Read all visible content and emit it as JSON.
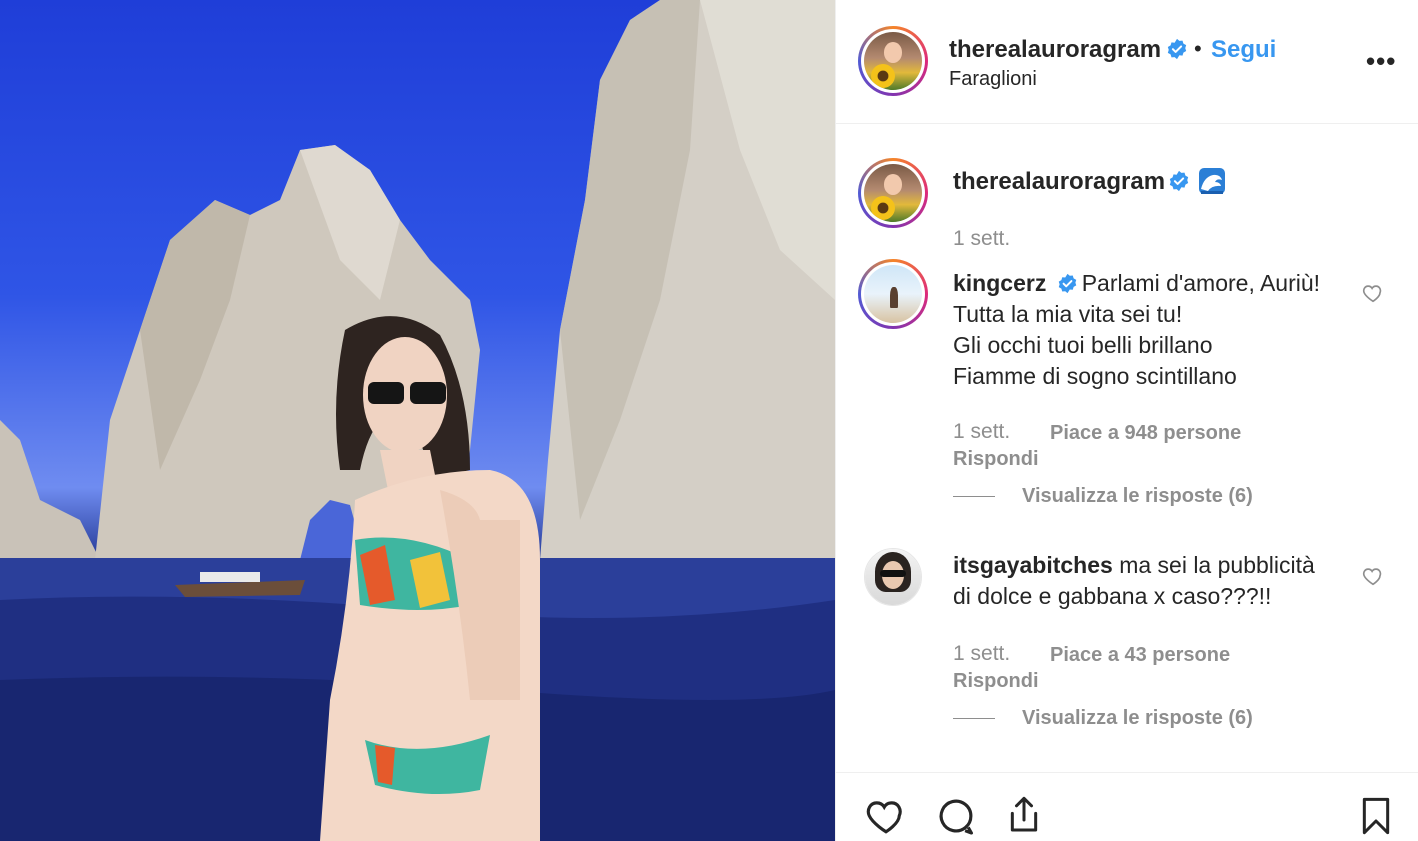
{
  "post": {
    "author": "therealauroragram",
    "follow_label": "Segui",
    "separator": "•",
    "location": "Faraglioni",
    "more_label": "•••"
  },
  "caption": {
    "author": "therealauroragram",
    "emoji_icon": "wave-emoji",
    "time": "1 sett."
  },
  "comments": [
    {
      "author": "kingcerz",
      "verified": true,
      "lines": [
        "Parlami d'amore, Auriù!",
        "Tutta la mia vita sei tu!",
        "Gli occhi tuoi belli brillano",
        "Fiamme di sogno scintillano"
      ],
      "time": "1 sett.",
      "likes": "Piace a 948 persone",
      "reply": "Rispondi",
      "view_replies": "Visualizza le risposte (6)"
    },
    {
      "author": "itsgayabitches",
      "verified": false,
      "lines": [
        "ma sei la pubblicità",
        "di dolce e gabbana x caso???!!"
      ],
      "time": "1 sett.",
      "likes": "Piace a 43 persone",
      "reply": "Rispondi",
      "view_replies": "Visualizza le risposte (6)"
    }
  ],
  "colors": {
    "link": "#3897f0",
    "muted": "#8e8e8e",
    "text": "#262626",
    "verified": "#3897f0"
  },
  "icons": [
    "heart-icon",
    "comment-icon",
    "share-icon",
    "bookmark-icon",
    "verified-badge-icon",
    "more-options-icon"
  ]
}
